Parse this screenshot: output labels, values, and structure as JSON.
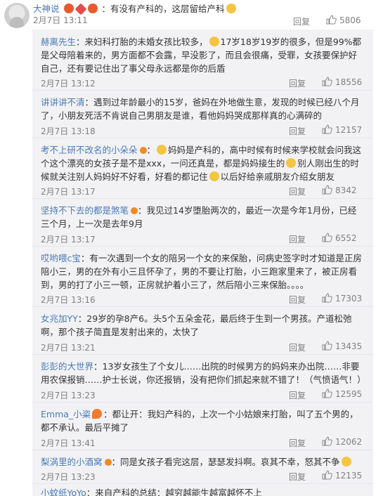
{
  "top": {
    "user": "大神说",
    "text": "：有没有产科的，这层留给产科",
    "time": "2月7日 13:11",
    "reply": "回复",
    "likes": "5806"
  },
  "comments": [
    {
      "user": "赫离先生",
      "text": "：来妇科打胎的未婚女孩比较多，",
      "text2": "17岁18岁19岁的很多，但是99%都是父母陪着来的，男方面都不会露，早没影了，而且会很痛，受罪，女孩要保护好自己，还有要记住出了事父母永远都是你的后盾",
      "time": "2月7日 13:12",
      "reply": "回复",
      "likes": "18556"
    },
    {
      "user": "讲讲讲不清",
      "text": "：遇到过年龄最小的15岁，爸妈在外地做生意，发现的时候已经八个月了，小朋友死活不肯说自己男朋友是谁，看他妈妈哭成那样真的心满碎的",
      "time": "2月7日 13:18",
      "reply": "回复",
      "likes": "12157"
    },
    {
      "user": "考不上研不改名的小朵朵",
      "text": "：",
      "text2": "妈妈是产科的，高中时候有时候来学校就会问我这个这个漂亮的女孩子是不是xxx，一问还真是，都是妈妈接生的",
      "text3": "别人刚出生的时候就关注别人妈妈好不好看，好看的都记住",
      "text4": "以后好给亲戚朋友介绍女朋友",
      "time": "2月7日 13:17",
      "reply": "回复",
      "likes": "8342"
    },
    {
      "user": "坚持不下去的都是煞笔",
      "text": "：我见过14岁堕胎两次的，最近一次是今年1月份，已经三个月，上一次是去年9月",
      "time": "2月7日 13:17",
      "reply": "回复",
      "likes": "6552"
    },
    {
      "user": "哎哟喂c宝",
      "text": "：有一次遇到一个女的陪另一个女的来保胎，问病史签字时才知道是正房陪小三，男的在外有小三且怀孕了，男的不要让打胎，小三跑家里来了，被正房看到，男的打了小三一顿，正房就护着小三了，然后陪小三来保胎。。。。",
      "time": "2月7日 13:16",
      "reply": "回复",
      "likes": "17303"
    },
    {
      "user": "女兆加YY",
      "text": "：29岁的孕8产6。头5个五朵金花，最后终于生到一个男孩。产道松弛啊，那个孩子简直是发射出来的，太快了",
      "time": "2月7日 13:21",
      "reply": "回复",
      "likes": "13435"
    },
    {
      "user": "彭彭的大世界",
      "text": "：13岁女孩生了个女儿……出院的时候男方的妈妈来办出院……非要用农保报销……护士长说，你还报销，没有把你们抓起来就不错了！（气愤语气！）",
      "time": "2月7日 13:23",
      "reply": "回复",
      "likes": "12595"
    },
    {
      "user": "Emma_小粢",
      "text": "：都让开：我妇产科的，上次一个小姑娘来打胎，叫了五个男的，都不承认。最后平摊了",
      "time": "2月7日 13:41",
      "reply": "回复",
      "likes": "12062"
    },
    {
      "user": "梨涡里的小酒窝",
      "text": "：同是女孩子看完这层，瑟瑟发抖啊。哀其不幸，怒其不争",
      "time": "2月7日 13:23",
      "reply": "回复",
      "likes": "12135"
    },
    {
      "user": "小蚊纸YoYo",
      "text": "：来自产科的总结：越穷越能生越富越怀不上"
    }
  ]
}
